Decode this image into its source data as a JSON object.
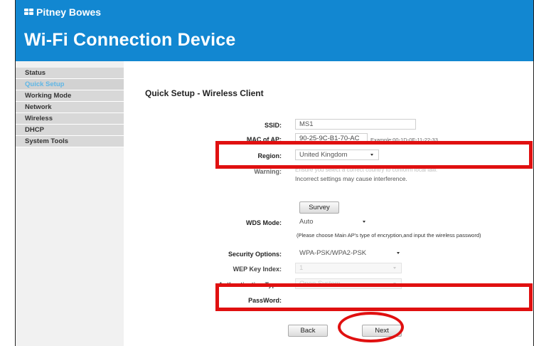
{
  "header": {
    "brand": "Pitney Bowes",
    "title": "Wi-Fi Connection Device"
  },
  "sidebar": {
    "items": [
      {
        "label": "Status",
        "active": false
      },
      {
        "label": "Quick Setup",
        "active": true
      },
      {
        "label": "Working Mode",
        "active": false
      },
      {
        "label": "Network",
        "active": false
      },
      {
        "label": "Wireless",
        "active": false
      },
      {
        "label": "DHCP",
        "active": false
      },
      {
        "label": "System Tools",
        "active": false
      }
    ]
  },
  "main": {
    "section_title": "Quick Setup - Wireless Client",
    "ssid": {
      "label": "SSID:",
      "value": "MS1"
    },
    "mac": {
      "label": "MAC of AP:",
      "value": "90-25-9C-B1-70-AC",
      "example": "Example:00-1D-0F-11-22-33"
    },
    "region": {
      "label": "Region:",
      "value": "United Kingdom"
    },
    "warning": {
      "label": "Warning:",
      "text_obscured": "Ensure you select a correct country to conform local law.",
      "text": "Incorrect settings may cause interference."
    },
    "survey_button": "Survey",
    "wds_mode": {
      "label": "WDS Mode:",
      "value": "Auto"
    },
    "wds_note": "(Please choose Main AP's type of encryption,and input the wireless password)",
    "security": {
      "label": "Security Options:",
      "value": "WPA-PSK/WPA2-PSK"
    },
    "wep_key_index": {
      "label": "WEP Key Index:",
      "value": "1"
    },
    "auth_type": {
      "label": "Authentication Type:",
      "value": "Open System"
    },
    "password": {
      "label": "PassWord:",
      "value": ""
    },
    "back_button": "Back",
    "next_button": "Next"
  },
  "annotations": {
    "highlight_color": "#e01010"
  }
}
